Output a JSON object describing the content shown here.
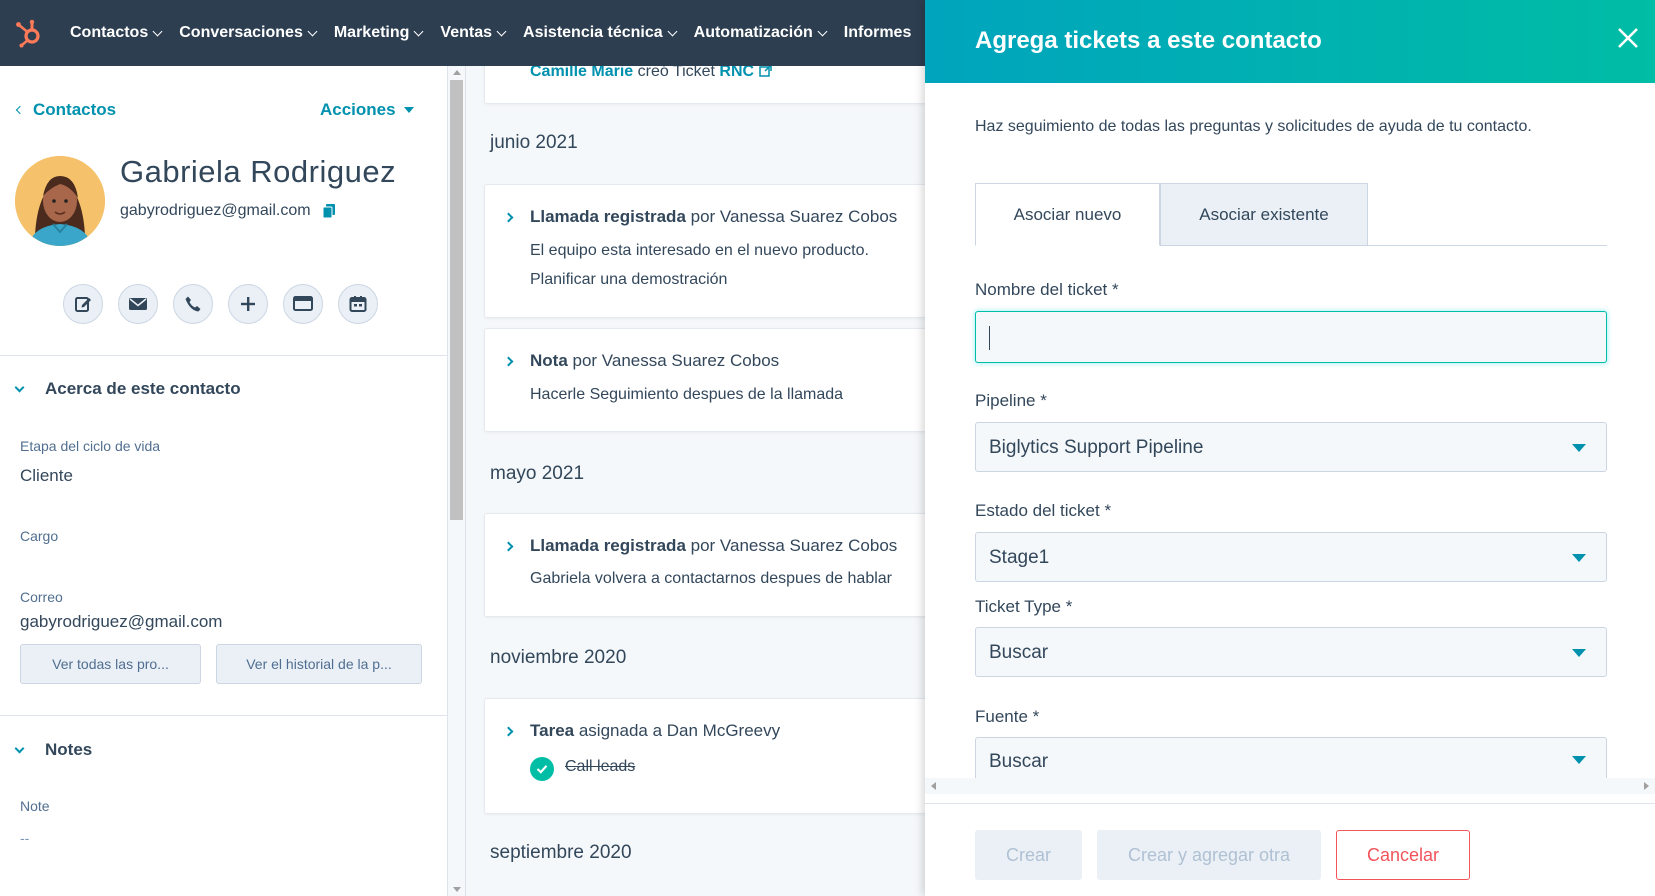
{
  "nav": {
    "items": [
      "Contactos",
      "Conversaciones",
      "Marketing",
      "Ventas",
      "Asistencia técnica",
      "Automatización",
      "Informes"
    ]
  },
  "sidebar": {
    "back_label": "Contactos",
    "actions_label": "Acciones",
    "contact_name": "Gabriela Rodriguez",
    "contact_email": "gabyrodriguez@gmail.com",
    "about_title": "Acerca de este contacto",
    "props": [
      {
        "label": "Etapa del ciclo de vida",
        "value": "Cliente"
      },
      {
        "label": "Cargo",
        "value": ""
      },
      {
        "label": "Correo",
        "value": "gabyrodriguez@gmail.com"
      }
    ],
    "btn_all_props": "Ver todas las pro...",
    "btn_history": "Ver el historial de la p...",
    "notes_title": "Notes",
    "note_label": "Note",
    "note_value": "--"
  },
  "timeline": {
    "top_partial": {
      "author": "Camille Marie",
      "text": "creó Ticket",
      "link": "RNC"
    },
    "months": [
      "junio 2021",
      "mayo 2021",
      "noviembre 2020",
      "septiembre 2020"
    ],
    "cards": [
      {
        "type": "Llamada registrada",
        "by": "por Vanessa Suarez Cobos",
        "lines": [
          "El equipo esta interesado en el nuevo producto.",
          "Planificar una demostración"
        ]
      },
      {
        "type": "Nota",
        "by": "por Vanessa Suarez Cobos",
        "lines": [
          "Hacerle Seguimiento despues de la llamada"
        ]
      },
      {
        "type": "Llamada registrada",
        "by": "por Vanessa Suarez Cobos",
        "lines": [
          "Gabriela volvera a contactarnos despues de hablar"
        ]
      },
      {
        "type": "Tarea",
        "by": "asignada a Dan McGreevy",
        "task": "Call leads"
      }
    ]
  },
  "panel": {
    "title": "Agrega tickets a este contacto",
    "description": "Haz seguimiento de todas las preguntas y solicitudes de ayuda de tu contacto.",
    "tabs": [
      "Asociar nuevo",
      "Asociar existente"
    ],
    "fields": {
      "ticket_name_label": "Nombre del ticket *",
      "ticket_name_value": "",
      "pipeline_label": "Pipeline *",
      "pipeline_value": "Biglytics Support Pipeline",
      "status_label": "Estado del ticket *",
      "status_value": "Stage1",
      "type_label": "Ticket Type *",
      "type_value": "Buscar",
      "source_label": "Fuente *",
      "source_value": "Buscar"
    },
    "buttons": {
      "create": "Crear",
      "create_another": "Crear y agregar otra",
      "cancel": "Cancelar"
    }
  },
  "colors": {
    "nav_bg": "#2d3e50",
    "accent": "#0091ae",
    "header_gradient_start": "#00a4bd",
    "header_gradient_end": "#00bda5",
    "cancel": "#f2545b"
  }
}
